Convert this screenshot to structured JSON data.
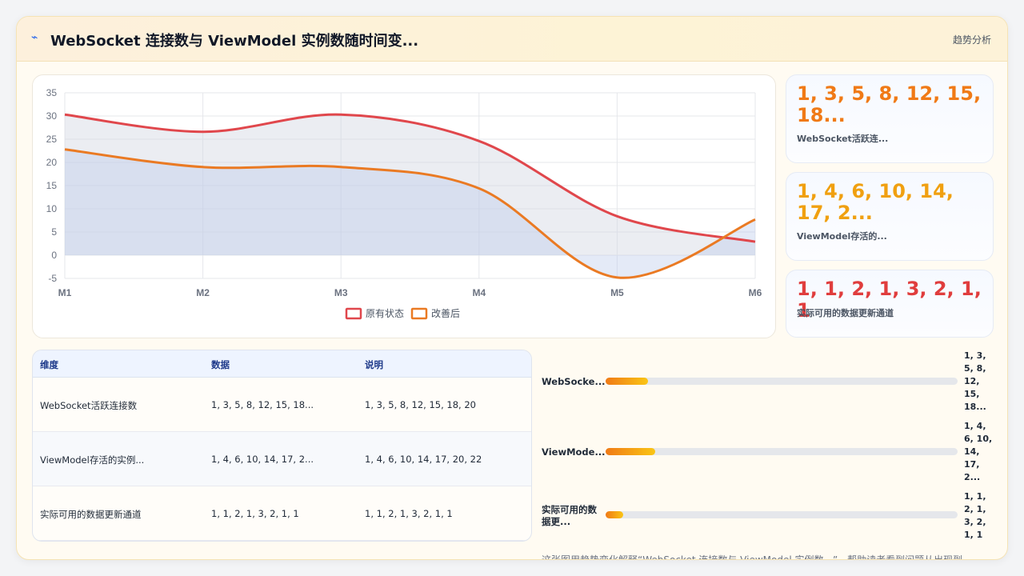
{
  "header": {
    "icon": "lightning-icon",
    "title": "WebSocket 连接数与 ViewModel 实例数随时间变...",
    "link": "趋势分析"
  },
  "chart_data": {
    "type": "area",
    "x": [
      "M1",
      "M2",
      "M3",
      "M4",
      "M5",
      "M6"
    ],
    "ylim": [
      -5,
      35
    ],
    "yticks": [
      "35",
      "30",
      "25",
      "20",
      "15",
      "10",
      "5",
      "0",
      "-5"
    ],
    "grid": true,
    "legend_position": "bottom",
    "series": [
      {
        "name": "原有状态",
        "values": [
          30.3,
          26.6,
          30.3,
          24.6,
          8.4,
          2.9
        ],
        "color": "#e0474c",
        "fill": "rgba(210,214,226,0.45)"
      },
      {
        "name": "改善后",
        "values": [
          22.8,
          19.0,
          19.0,
          14.4,
          -4.8,
          7.7
        ],
        "color": "#ea7a23",
        "fill": "rgba(188,203,234,0.4)"
      }
    ]
  },
  "stats": [
    {
      "value": "1, 3, 5, 8, 12, 15, 18...",
      "label": "WebSocket活跃连...",
      "color": "#f07a16"
    },
    {
      "value": "1, 4, 6, 10, 14, 17, 2...",
      "label": "ViewModel存活的...",
      "color": "#f0a010"
    },
    {
      "value": "1, 1, 2, 1, 3, 2, 1, 1",
      "label": "实际可用的数据更新通道",
      "color": "#e03d3d"
    }
  ],
  "table": {
    "headers": [
      "维度",
      "数据",
      "说明"
    ],
    "rows": [
      [
        "WebSocket活跃连接数",
        "1, 3, 5, 8, 12, 15, 18...",
        "1, 3, 5, 8, 12, 15, 18, 20"
      ],
      [
        "ViewModel存活的实例...",
        "1, 4, 6, 10, 14, 17, 2...",
        "1, 4, 6, 10, 14, 17, 20, 22"
      ],
      [
        "实际可用的数据更新通道",
        "1, 1, 2, 1, 3, 2, 1, 1",
        "1, 1, 2, 1, 3, 2, 1, 1"
      ]
    ]
  },
  "bars": [
    {
      "label": "WebSocke...",
      "value_lines": [
        "1, 3,",
        "5, 8,",
        "12,",
        "15,",
        "18..."
      ],
      "fraction": 0.12
    },
    {
      "label": "ViewMode...",
      "value_lines": [
        "1, 4,",
        "6, 10,",
        "14,",
        "17,",
        "2..."
      ],
      "fraction": 0.14
    },
    {
      "label_lines": [
        "实际可用的数",
        "据更..."
      ],
      "value_lines": [
        "1, 1,",
        "2, 1,",
        "3, 2,",
        "1, 1"
      ],
      "fraction": 0.05
    }
  ],
  "note": "这张图用趋势变化解释“WebSocket 连接数与 ViewModel 实例数...”，帮助读者看到问题从出现到"
}
